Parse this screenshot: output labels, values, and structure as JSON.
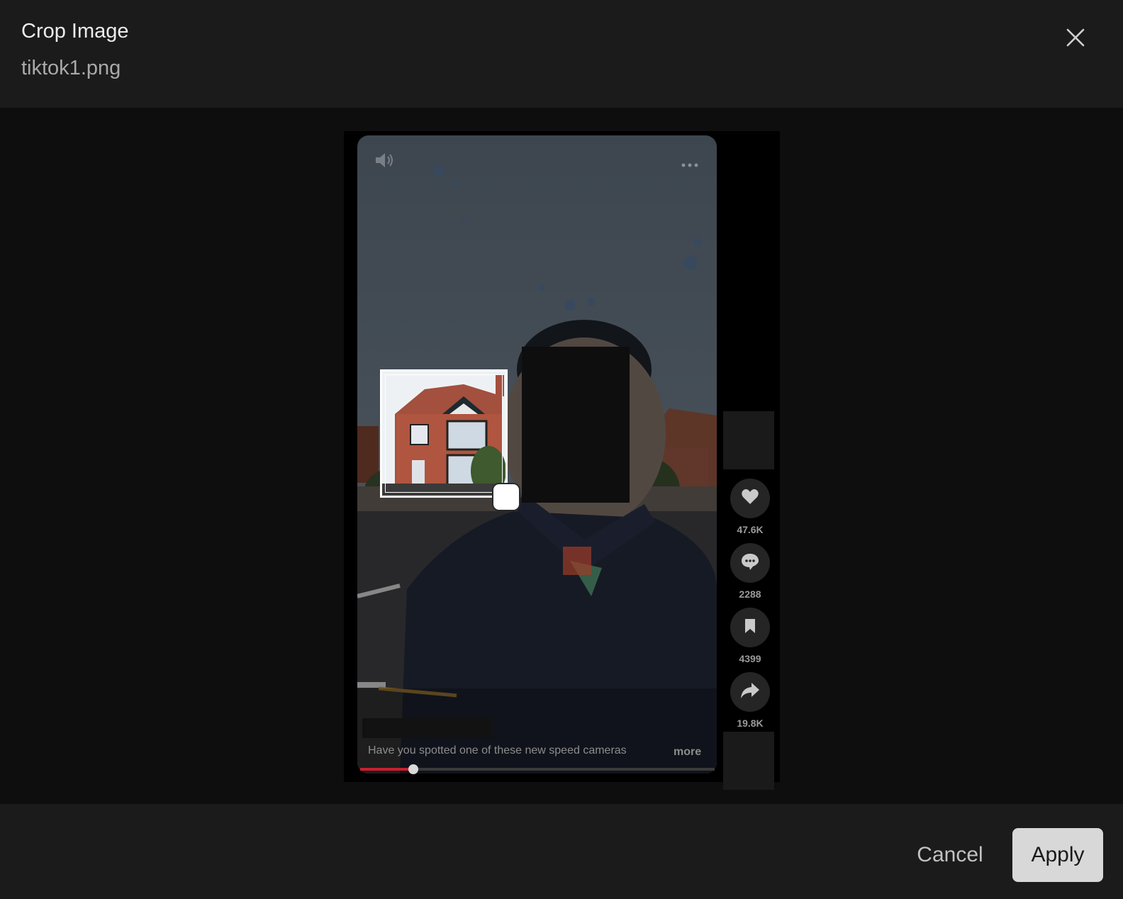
{
  "dialog": {
    "title": "Crop Image",
    "filename": "tiktok1.png"
  },
  "video": {
    "caption": "Have you spotted one of these new speed cameras",
    "more_label": "more",
    "progress": 0.15
  },
  "actions": [
    {
      "icon": "heart-icon",
      "count": "47.6K"
    },
    {
      "icon": "comment-icon",
      "count": "2288"
    },
    {
      "icon": "bookmark-icon",
      "count": "4399"
    },
    {
      "icon": "share-icon",
      "count": "19.8K"
    }
  ],
  "footer": {
    "cancel_label": "Cancel",
    "apply_label": "Apply"
  },
  "colors": {
    "accent_progress": "#c8202e",
    "apply_button": "#d8d8d8"
  }
}
